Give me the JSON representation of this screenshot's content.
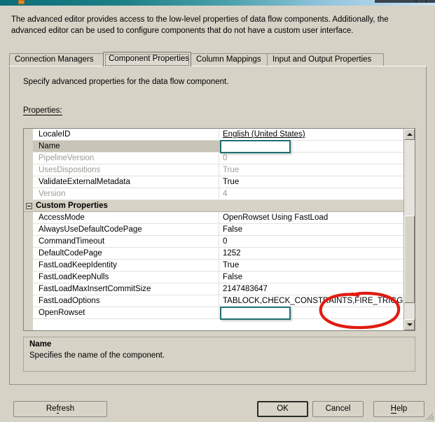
{
  "window": {
    "title_visible": false,
    "accent_teal": "#0b6f78",
    "dialog_bg": "#d6d2c6"
  },
  "intro": {
    "text": "The advanced editor provides access to the low-level properties of data flow components. Additionally, the advanced editor can be used to configure components that do not have a custom user interface."
  },
  "tabs": {
    "selected_index": 1,
    "items": [
      {
        "label": "Connection Managers"
      },
      {
        "label": "Component Properties"
      },
      {
        "label": "Column Mappings"
      },
      {
        "label": "Input and Output Properties"
      }
    ]
  },
  "page": {
    "hint": "Specify advanced properties for the data flow component.",
    "properties_label": "Properties:"
  },
  "grid": {
    "rows": [
      {
        "kind": "row",
        "name": "LocaleID",
        "value": "English (United States)",
        "disabled": false,
        "selected": false,
        "underline_value": true,
        "editbox": false
      },
      {
        "kind": "row",
        "name": "Name",
        "value": "",
        "disabled": false,
        "selected": true,
        "underline_value": false,
        "editbox": true
      },
      {
        "kind": "row",
        "name": "PipelineVersion",
        "value": "0",
        "disabled": true,
        "selected": false,
        "underline_value": false,
        "editbox": false
      },
      {
        "kind": "row",
        "name": "UsesDispositions",
        "value": "True",
        "disabled": true,
        "selected": false,
        "underline_value": false,
        "editbox": false
      },
      {
        "kind": "row",
        "name": "ValidateExternalMetadata",
        "value": "True",
        "disabled": false,
        "selected": false,
        "underline_value": false,
        "editbox": false
      },
      {
        "kind": "row",
        "name": "Version",
        "value": "4",
        "disabled": true,
        "selected": false,
        "underline_value": false,
        "editbox": false
      },
      {
        "kind": "header",
        "name": "Custom Properties",
        "expanded": true
      },
      {
        "kind": "row",
        "name": "AccessMode",
        "value": "OpenRowset Using FastLoad",
        "disabled": false,
        "selected": false,
        "underline_value": false,
        "editbox": false
      },
      {
        "kind": "row",
        "name": "AlwaysUseDefaultCodePage",
        "value": "False",
        "disabled": false,
        "selected": false,
        "underline_value": false,
        "editbox": false
      },
      {
        "kind": "row",
        "name": "CommandTimeout",
        "value": "0",
        "disabled": false,
        "selected": false,
        "underline_value": false,
        "editbox": false
      },
      {
        "kind": "row",
        "name": "DefaultCodePage",
        "value": "1252",
        "disabled": false,
        "selected": false,
        "underline_value": false,
        "editbox": false
      },
      {
        "kind": "row",
        "name": "FastLoadKeepIdentity",
        "value": "True",
        "disabled": false,
        "selected": false,
        "underline_value": false,
        "editbox": false
      },
      {
        "kind": "row",
        "name": "FastLoadKeepNulls",
        "value": "False",
        "disabled": false,
        "selected": false,
        "underline_value": false,
        "editbox": false
      },
      {
        "kind": "row",
        "name": "FastLoadMaxInsertCommitSize",
        "value": "2147483647",
        "disabled": false,
        "selected": false,
        "underline_value": false,
        "editbox": false
      },
      {
        "kind": "row",
        "name": "FastLoadOptions",
        "value": "TABLOCK,CHECK_CONSTRAINTS,FIRE_TRIGGERS",
        "disabled": false,
        "selected": false,
        "underline_value": false,
        "editbox": false
      },
      {
        "kind": "row",
        "name": "OpenRowset",
        "value": "",
        "disabled": false,
        "selected": false,
        "underline_value": false,
        "editbox": true
      }
    ],
    "scrollbar": {
      "thumb_top_pct": 42,
      "thumb_height_pct": 49
    }
  },
  "description": {
    "title": "Name",
    "text": "Specifies the name of the component."
  },
  "footer": {
    "refresh_label": "Refresh",
    "refresh_accel": "f",
    "ok_label": "OK",
    "cancel_label": "Cancel",
    "help_label": "Help",
    "help_accel": "H"
  },
  "annotation": {
    "shape": "ellipse",
    "color": "#e01b11",
    "target_text": "FIRE_TRIGGERS"
  }
}
